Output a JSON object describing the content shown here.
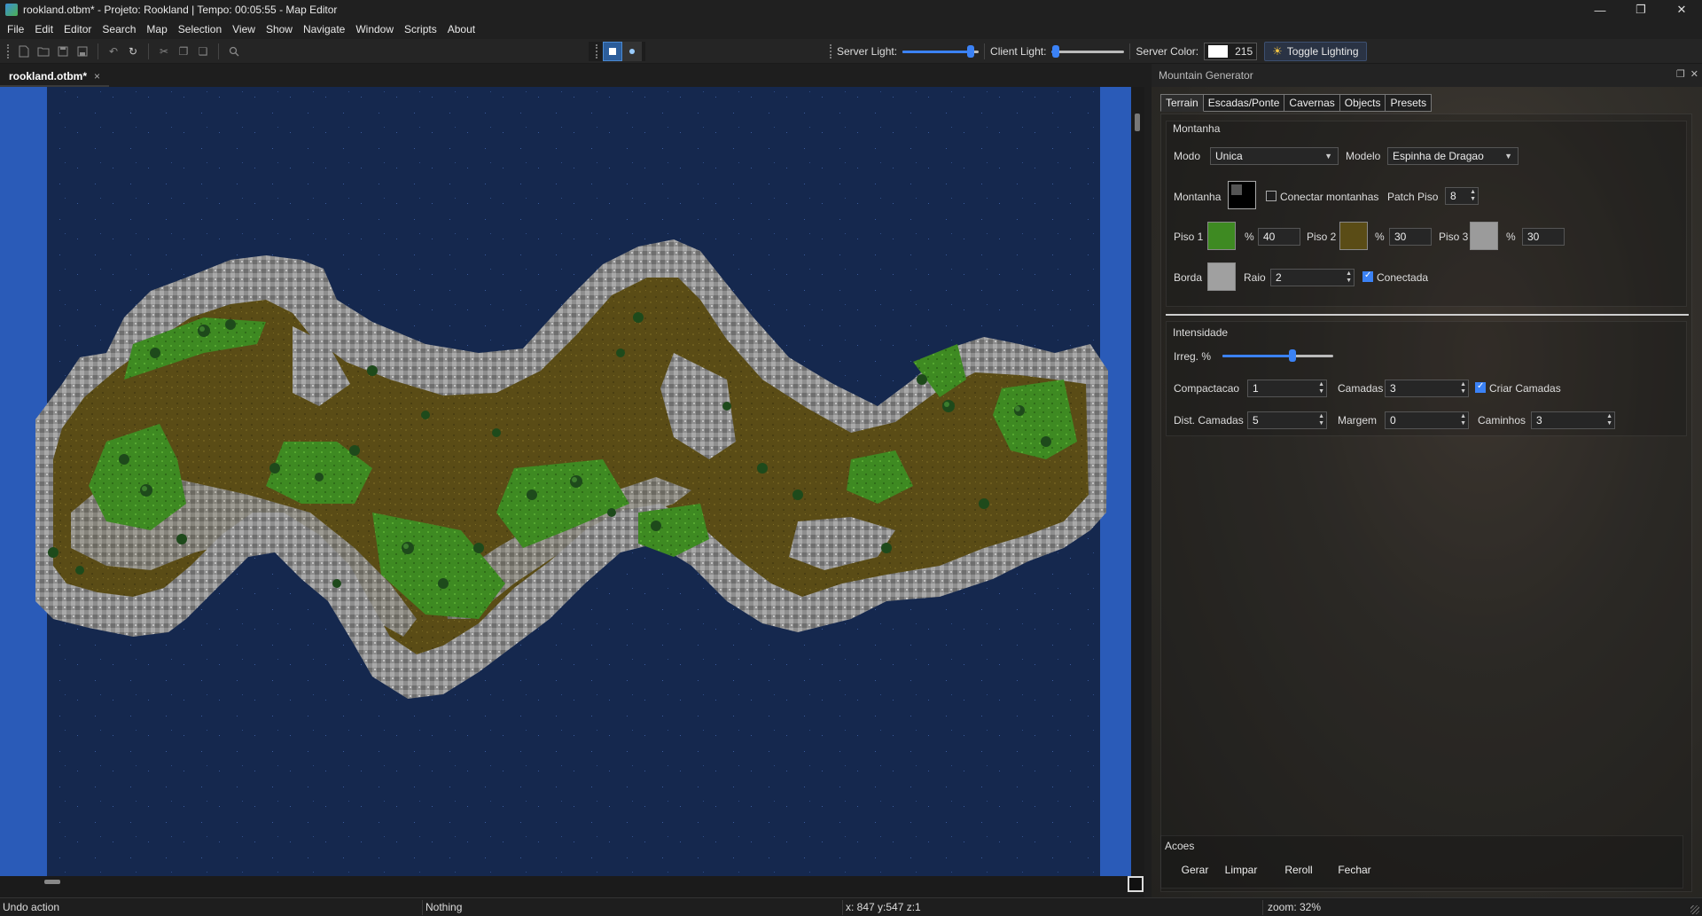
{
  "window": {
    "title": "rookland.otbm* - Projeto: Rookland | Tempo: 00:05:55 - Map Editor",
    "controls": [
      "minimize",
      "restore",
      "close"
    ]
  },
  "menu": [
    "File",
    "Edit",
    "Editor",
    "Search",
    "Map",
    "Selection",
    "View",
    "Show",
    "Navigate",
    "Window",
    "Scripts",
    "About"
  ],
  "toolbar": {
    "icons": [
      "new-file-icon",
      "open-folder-icon",
      "save-icon",
      "save-all-icon",
      "undo-icon",
      "redo-icon",
      "cut-icon",
      "copy-icon",
      "paste-icon",
      "search-icon"
    ],
    "server_light_label": "Server Light:",
    "server_light_level": 0.9,
    "client_light_label": "Client Light:",
    "client_light_level": 0.05,
    "server_color_label": "Server Color:",
    "server_color_value": "215",
    "server_color_swatch": "#ffffff",
    "toggle_lighting_label": "Toggle Lighting"
  },
  "document_tab": {
    "label": "rookland.otbm*",
    "close": "×"
  },
  "map": {
    "water_color": "#15284e",
    "edge_color": "#2a5bb8"
  },
  "panel": {
    "title": "Mountain Generator",
    "tabs": [
      "Terrain",
      "Escadas/Ponte",
      "Cavernas",
      "Objects",
      "Presets"
    ],
    "montanha_group": "Montanha",
    "modo_label": "Modo",
    "modo_value": "Unica",
    "modelo_label": "Modelo",
    "modelo_value": "Espinha de Dragao",
    "montanha_label": "Montanha",
    "conectar_label": "Conectar montanhas",
    "conectar_checked": false,
    "patch_piso_label": "Patch Piso",
    "patch_piso_value": "8",
    "piso1_label": "Piso 1",
    "piso1_pct": "40",
    "piso2_label": "Piso 2",
    "piso2_pct": "30",
    "piso3_label": "Piso 3",
    "piso3_pct": "30",
    "pct_symbol": "%",
    "borda_label": "Borda",
    "raio_label": "Raio",
    "raio_value": "2",
    "conectada_label": "Conectada",
    "conectada_checked": true,
    "intensidade_group": "Intensidade",
    "irreg_label": "Irreg. %",
    "irreg_level": 0.63,
    "compactacao_label": "Compactacao",
    "compactacao_value": "1",
    "camadas_label": "Camadas",
    "camadas_value": "3",
    "criar_camadas_label": "Criar Camadas",
    "criar_camadas_checked": true,
    "dist_camadas_label": "Dist. Camadas",
    "dist_camadas_value": "5",
    "margem_label": "Margem",
    "margem_value": "0",
    "caminhos_label": "Caminhos",
    "caminhos_value": "3",
    "acoes_group": "Acoes",
    "actions": [
      "Gerar",
      "Limpar",
      "Reroll",
      "Fechar"
    ]
  },
  "status": {
    "action": "Undo action",
    "selection": "Nothing",
    "coords": "x: 847 y:547 z:1",
    "zoom": "zoom: 32%"
  }
}
